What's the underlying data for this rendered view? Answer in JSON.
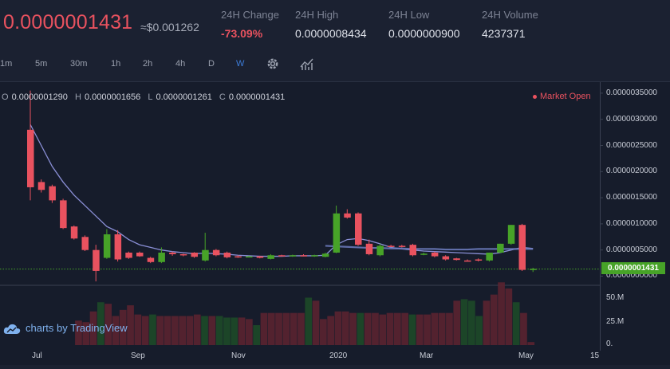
{
  "header": {
    "price": "0.0000001431",
    "usd_price": "≈$0.001262",
    "stats": [
      {
        "label": "24H Change",
        "value": "-73.09%",
        "negative": true
      },
      {
        "label": "24H High",
        "value": "0.0000008434",
        "negative": false
      },
      {
        "label": "24H Low",
        "value": "0.0000000900",
        "negative": false
      },
      {
        "label": "24H Volume",
        "value": "4237371",
        "negative": false
      }
    ]
  },
  "toolbar": {
    "intervals": [
      "1m",
      "5m",
      "30m",
      "1h",
      "2h",
      "4h",
      "D",
      "W"
    ],
    "active_interval": "W",
    "icons": [
      "gear-icon",
      "indicators-icon"
    ]
  },
  "legend": {
    "o_label": "O",
    "o": "0.0000001290",
    "h_label": "H",
    "h": "0.0000001656",
    "l_label": "L",
    "l": "0.0000001261",
    "c_label": "C",
    "c": "0.0000001431",
    "market_status": "Market Open"
  },
  "colors": {
    "up": "#47a328",
    "down": "#e9525f",
    "ma": "#8a8fd6",
    "accent": "#3d7ddb"
  },
  "chart_data": {
    "type": "candlestick",
    "price_axis": {
      "ticks": [
        "0.0000035000",
        "0.0000030000",
        "0.0000025000",
        "0.0000020000",
        "0.0000015000",
        "0.0000010000",
        "0.0000005000",
        "0.0000000000"
      ],
      "last_price": "0.0000001431"
    },
    "volume_axis": {
      "ticks": [
        "50.M",
        "25.M",
        "0."
      ]
    },
    "x_ticks": [
      "Jul",
      "Sep",
      "Nov",
      "2020",
      "Mar",
      "May",
      "15"
    ],
    "candles": [
      {
        "o": 2.8,
        "h": 3.55,
        "l": 1.45,
        "c": 1.7
      },
      {
        "o": 1.8,
        "h": 1.85,
        "l": 1.6,
        "c": 1.65
      },
      {
        "o": 1.72,
        "h": 1.75,
        "l": 1.4,
        "c": 1.45
      },
      {
        "o": 1.45,
        "h": 1.48,
        "l": 0.9,
        "c": 0.92
      },
      {
        "o": 0.95,
        "h": 0.97,
        "l": 0.7,
        "c": 0.72
      },
      {
        "o": 0.75,
        "h": 0.78,
        "l": 0.48,
        "c": 0.5
      },
      {
        "o": 0.5,
        "h": 0.6,
        "l": -0.1,
        "c": 0.1
      },
      {
        "o": 0.35,
        "h": 0.9,
        "l": 0.33,
        "c": 0.8
      },
      {
        "o": 0.8,
        "h": 0.88,
        "l": 0.28,
        "c": 0.32
      },
      {
        "o": 0.45,
        "h": 0.47,
        "l": 0.33,
        "c": 0.35
      },
      {
        "o": 0.45,
        "h": 0.47,
        "l": 0.37,
        "c": 0.38
      },
      {
        "o": 0.35,
        "h": 0.37,
        "l": 0.25,
        "c": 0.27
      },
      {
        "o": 0.27,
        "h": 0.55,
        "l": 0.25,
        "c": 0.45
      },
      {
        "o": 0.45,
        "h": 0.47,
        "l": 0.39,
        "c": 0.42
      },
      {
        "o": 0.42,
        "h": 0.43,
        "l": 0.38,
        "c": 0.4
      },
      {
        "o": 0.45,
        "h": 0.46,
        "l": 0.35,
        "c": 0.37
      },
      {
        "o": 0.3,
        "h": 0.83,
        "l": 0.28,
        "c": 0.5
      },
      {
        "o": 0.5,
        "h": 0.52,
        "l": 0.38,
        "c": 0.4
      },
      {
        "o": 0.45,
        "h": 0.47,
        "l": 0.34,
        "c": 0.36
      },
      {
        "o": 0.38,
        "h": 0.4,
        "l": 0.35,
        "c": 0.37
      },
      {
        "o": 0.37,
        "h": 0.39,
        "l": 0.36,
        "c": 0.38
      },
      {
        "o": 0.38,
        "h": 0.39,
        "l": 0.34,
        "c": 0.35
      },
      {
        "o": 0.33,
        "h": 0.42,
        "l": 0.32,
        "c": 0.4
      },
      {
        "o": 0.4,
        "h": 0.41,
        "l": 0.38,
        "c": 0.39
      },
      {
        "o": 0.39,
        "h": 0.41,
        "l": 0.37,
        "c": 0.4
      },
      {
        "o": 0.4,
        "h": 0.42,
        "l": 0.38,
        "c": 0.39
      },
      {
        "o": 0.39,
        "h": 0.41,
        "l": 0.37,
        "c": 0.4
      },
      {
        "o": 0.37,
        "h": 0.45,
        "l": 0.36,
        "c": 0.43
      },
      {
        "o": 0.45,
        "h": 1.35,
        "l": 0.44,
        "c": 1.2
      },
      {
        "o": 1.2,
        "h": 1.28,
        "l": 1.1,
        "c": 1.12
      },
      {
        "o": 1.2,
        "h": 1.22,
        "l": 0.58,
        "c": 0.6
      },
      {
        "o": 0.62,
        "h": 0.7,
        "l": 0.4,
        "c": 0.42
      },
      {
        "o": 0.4,
        "h": 0.62,
        "l": 0.38,
        "c": 0.58
      },
      {
        "o": 0.58,
        "h": 0.6,
        "l": 0.56,
        "c": 0.57
      },
      {
        "o": 0.58,
        "h": 0.6,
        "l": 0.55,
        "c": 0.56
      },
      {
        "o": 0.6,
        "h": 0.62,
        "l": 0.38,
        "c": 0.4
      },
      {
        "o": 0.42,
        "h": 0.45,
        "l": 0.4,
        "c": 0.43
      },
      {
        "o": 0.45,
        "h": 0.47,
        "l": 0.36,
        "c": 0.38
      },
      {
        "o": 0.38,
        "h": 0.4,
        "l": 0.3,
        "c": 0.32
      },
      {
        "o": 0.34,
        "h": 0.35,
        "l": 0.3,
        "c": 0.31
      },
      {
        "o": 0.3,
        "h": 0.32,
        "l": 0.28,
        "c": 0.29
      },
      {
        "o": 0.32,
        "h": 0.34,
        "l": 0.28,
        "c": 0.3
      },
      {
        "o": 0.3,
        "h": 0.45,
        "l": 0.28,
        "c": 0.45
      },
      {
        "o": 0.45,
        "h": 0.62,
        "l": 0.44,
        "c": 0.62
      },
      {
        "o": 0.62,
        "h": 0.98,
        "l": 0.6,
        "c": 0.98
      },
      {
        "o": 0.98,
        "h": 1.0,
        "l": 0.1,
        "c": 0.12
      },
      {
        "o": 0.12,
        "h": 0.16,
        "l": 0.08,
        "c": 0.14
      }
    ],
    "ma": [
      2.9,
      2.5,
      2.1,
      1.8,
      1.55,
      1.35,
      1.15,
      0.95,
      0.85,
      0.7,
      0.6,
      0.55,
      0.5,
      0.47,
      0.45,
      0.43,
      0.44,
      0.43,
      0.42,
      0.4,
      0.39,
      0.38,
      0.38,
      0.38,
      0.39,
      0.39,
      0.39,
      0.4,
      0.6,
      0.7,
      0.72,
      0.68,
      0.62,
      0.55,
      0.52,
      0.5,
      0.48,
      0.47,
      0.46,
      0.45,
      0.44,
      0.43,
      0.42,
      0.45,
      0.5,
      0.55,
      0.53
    ],
    "ma2": [
      0.58,
      0.57,
      0.56,
      0.55,
      0.54,
      0.54,
      0.53,
      0.53,
      0.52,
      0.52,
      0.52,
      0.51,
      0.51,
      0.51,
      0.52,
      0.52,
      0.52,
      0.52,
      0.52,
      0.52
    ],
    "volumes": [
      0,
      0,
      0,
      0,
      0,
      0,
      0,
      32,
      30,
      44,
      56,
      54,
      38,
      46,
      52,
      40,
      38,
      40,
      38,
      38,
      38,
      38,
      38,
      40,
      38,
      38,
      38,
      36,
      36,
      36,
      34,
      26,
      42,
      42,
      42,
      42,
      42,
      42,
      62,
      58,
      34,
      38,
      44,
      44,
      42,
      42,
      42,
      42,
      40,
      42,
      42,
      42,
      40,
      40,
      40,
      42,
      42,
      42,
      58,
      60,
      58,
      38,
      58,
      66,
      82,
      74,
      56,
      42,
      4
    ]
  },
  "branding": {
    "label": "charts by TradingView"
  }
}
